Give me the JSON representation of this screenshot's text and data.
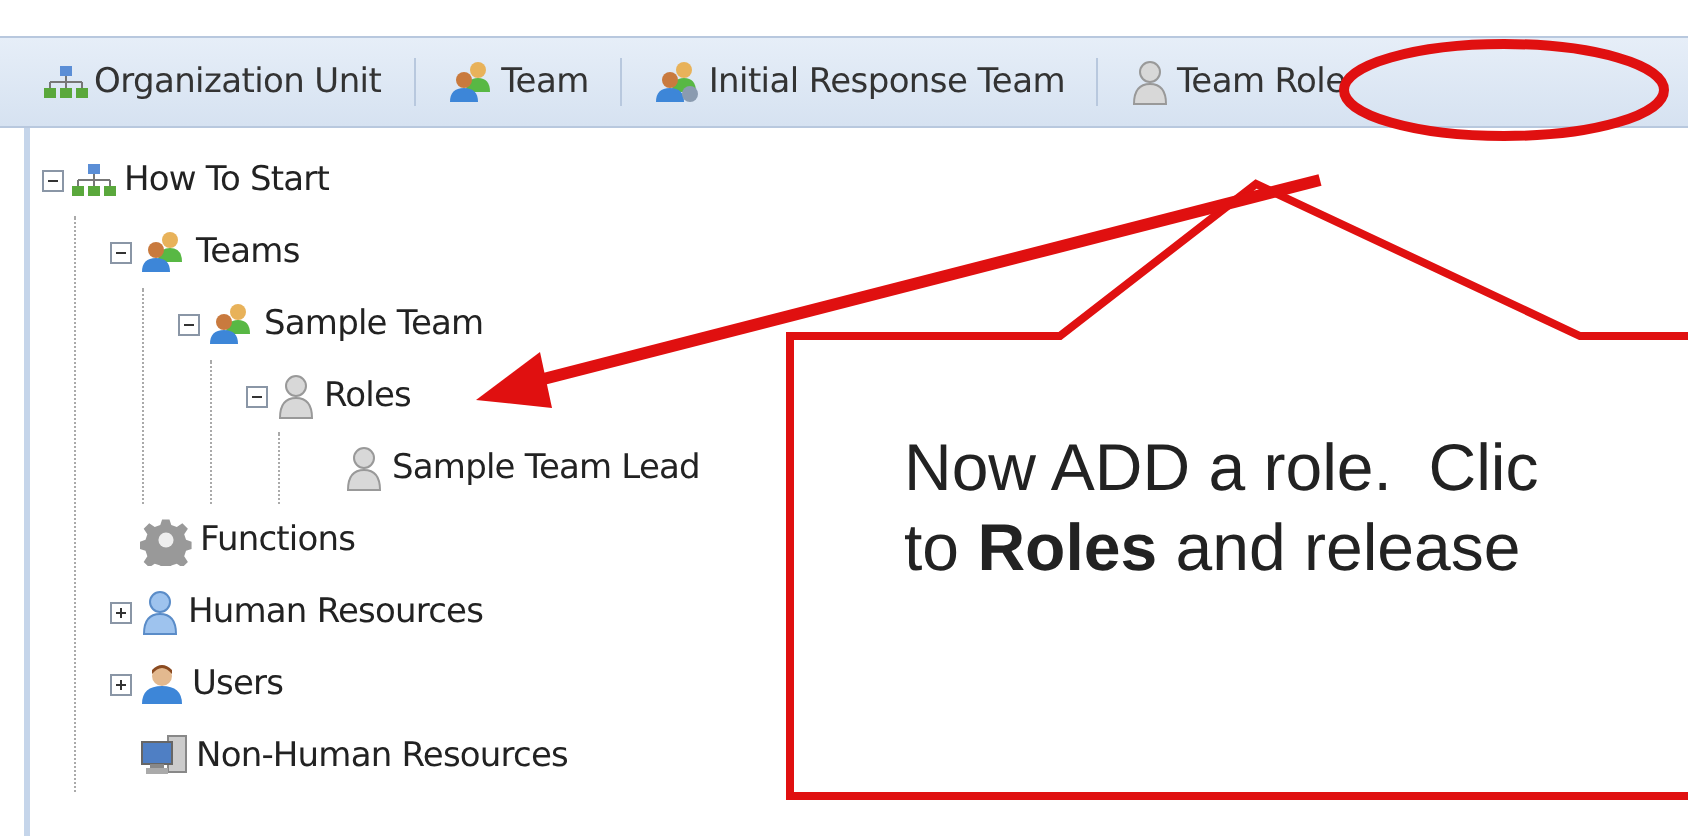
{
  "toolbar": [
    {
      "label": "Organization Unit",
      "kind": "org"
    },
    {
      "label": "Team",
      "kind": "team"
    },
    {
      "label": "Initial Response Team",
      "kind": "response"
    },
    {
      "label": "Team Role",
      "kind": "role"
    }
  ],
  "tree": [
    {
      "label": "How To Start",
      "kind": "org",
      "expanded": true,
      "children": [
        {
          "label": "Teams",
          "kind": "team",
          "expanded": true,
          "children": [
            {
              "label": "Sample Team",
              "kind": "team",
              "expanded": true,
              "children": [
                {
                  "label": "Roles",
                  "kind": "role",
                  "expanded": true,
                  "children": [
                    {
                      "label": "Sample Team Lead",
                      "kind": "role"
                    }
                  ]
                }
              ]
            }
          ]
        },
        {
          "label": "Functions",
          "kind": "function"
        },
        {
          "label": "Human Resources",
          "kind": "resource",
          "expanded": false
        },
        {
          "label": "Users",
          "kind": "user",
          "expanded": false
        },
        {
          "label": "Non-Human Resources",
          "kind": "device"
        }
      ]
    }
  ],
  "callout": {
    "lines": [
      "Now ADD a role.  Clic",
      "to **Roles** and release"
    ]
  }
}
